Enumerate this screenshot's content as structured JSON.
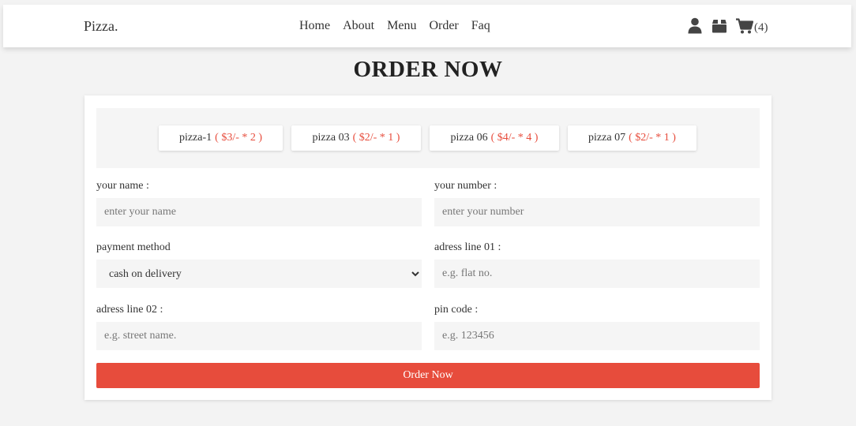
{
  "header": {
    "logo": "Pizza.",
    "nav": [
      "Home",
      "About",
      "Menu",
      "Order",
      "Faq"
    ],
    "icons": [
      "user-icon",
      "box-icon",
      "cart-icon"
    ],
    "cart_count": "(4)"
  },
  "order": {
    "heading": "ORDER NOW",
    "items": [
      {
        "name": "pizza-1",
        "price": "( $3/- * 2 )"
      },
      {
        "name": "pizza 03",
        "price": "( $2/- * 1 )"
      },
      {
        "name": "pizza 06",
        "price": "( $4/- * 4 )"
      },
      {
        "name": "pizza 07",
        "price": "( $2/- * 1 )"
      }
    ],
    "fields": {
      "name": {
        "label": "your name :",
        "placeholder": "enter your name"
      },
      "number": {
        "label": "your number :",
        "placeholder": "enter your number"
      },
      "payment": {
        "label": "payment method",
        "selected": "cash on delivery"
      },
      "address1": {
        "label": "adress line 01 :",
        "placeholder": "e.g. flat no."
      },
      "address2": {
        "label": "adress line 02 :",
        "placeholder": "e.g. street name."
      },
      "pin": {
        "label": "pin code :",
        "placeholder": "e.g. 123456"
      }
    },
    "submit_label": "Order Now"
  },
  "colors": {
    "accent": "#e74c3c",
    "background": "#f3f3f3",
    "field_background": "#f5f5f5"
  }
}
